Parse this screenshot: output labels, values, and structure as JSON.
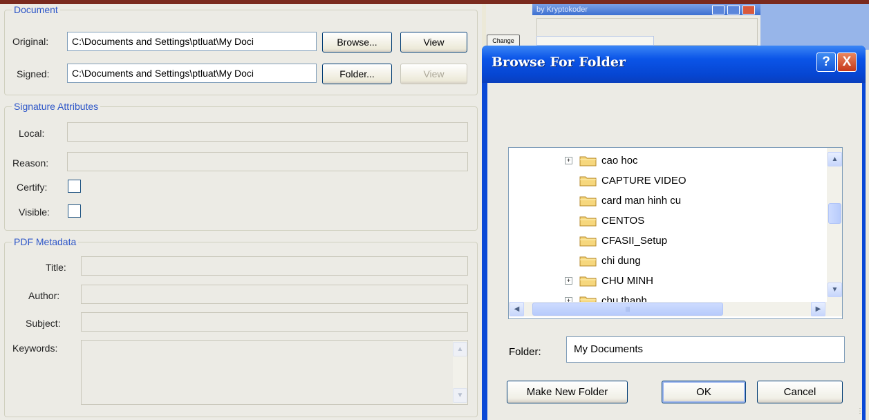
{
  "left_app": {
    "document_group": {
      "legend": "Document",
      "original_label": "Original:",
      "original_value": "C:\\Documents and Settings\\ptluat\\My Doci",
      "signed_label": "Signed:",
      "signed_value": "C:\\Documents and Settings\\ptluat\\My Doci",
      "browse_button": "Browse...",
      "folder_button": "Folder...",
      "view_button": "View",
      "view_button_2": "View"
    },
    "signature_group": {
      "legend": "Signature Attributes",
      "local_label": "Local:",
      "reason_label": "Reason:",
      "certify_label": "Certify:",
      "visible_label": "Visible:"
    },
    "metadata_group": {
      "legend": "PDF Metadata",
      "title_label": "Title:",
      "author_label": "Author:",
      "subject_label": "Subject:",
      "keywords_label": "Keywords:"
    }
  },
  "background_window": {
    "title": "by Kryptokoder",
    "change_button": "Change"
  },
  "dialog": {
    "title": "Browse For Folder",
    "help_button": "?",
    "close_button": "X",
    "tree_items": [
      {
        "label": "cao hoc",
        "expandable": true
      },
      {
        "label": "CAPTURE VIDEO",
        "expandable": false
      },
      {
        "label": "card man hinh cu",
        "expandable": false
      },
      {
        "label": "CENTOS",
        "expandable": false
      },
      {
        "label": "CFASII_Setup",
        "expandable": false
      },
      {
        "label": "chi dung",
        "expandable": false
      },
      {
        "label": "CHU MINH",
        "expandable": true
      },
      {
        "label": "chu thanh",
        "expandable": true
      }
    ],
    "folder_label": "Folder:",
    "folder_value": "My Documents",
    "make_new_folder_button": "Make New Folder",
    "ok_button": "OK",
    "cancel_button": "Cancel"
  }
}
